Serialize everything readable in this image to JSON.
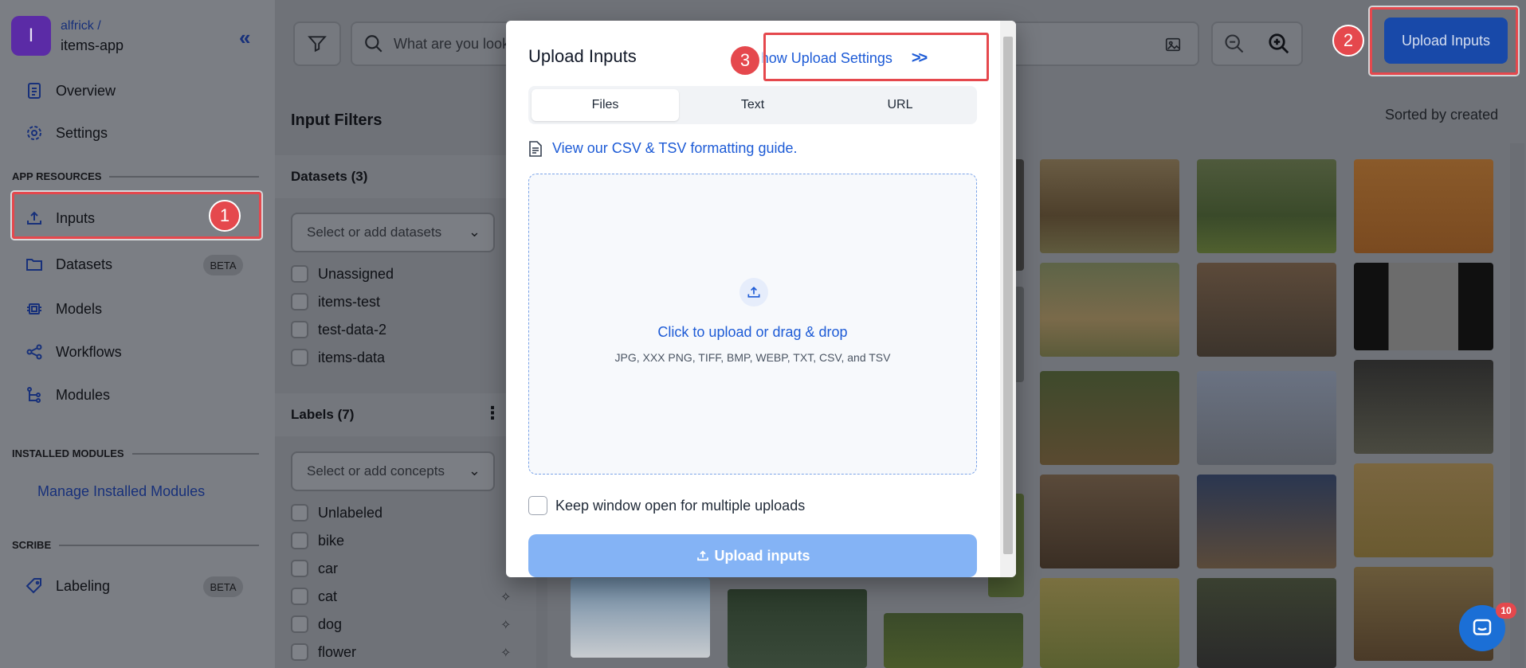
{
  "app": {
    "initial": "I",
    "user": "alfrick /",
    "name": "items-app"
  },
  "sidebar": {
    "top_items": [
      {
        "label": "Overview",
        "icon": "document-icon"
      },
      {
        "label": "Settings",
        "icon": "gear-icon"
      }
    ],
    "app_resources_label": "APP RESOURCES",
    "resource_items": [
      {
        "label": "Inputs",
        "icon": "upload-icon"
      },
      {
        "label": "Datasets",
        "icon": "folder-icon",
        "badge": "BETA"
      },
      {
        "label": "Models",
        "icon": "chip-icon"
      },
      {
        "label": "Workflows",
        "icon": "share-icon"
      },
      {
        "label": "Modules",
        "icon": "tree-icon"
      }
    ],
    "installed_modules_label": "INSTALLED MODULES",
    "manage_modules": "Manage Installed Modules",
    "scribe_label": "SCRIBE",
    "scribe_items": [
      {
        "label": "Labeling",
        "icon": "tag-icon",
        "badge": "BETA"
      }
    ]
  },
  "steps": {
    "one": "1",
    "two": "2",
    "three": "3"
  },
  "topbar": {
    "search_placeholder": "What are you look",
    "upload_button": "Upload Inputs"
  },
  "filters": {
    "title": "Input Filters",
    "sorted": "Sorted by created",
    "datasets_title": "Datasets (3)",
    "datasets_placeholder": "Select or add datasets",
    "datasets": [
      "Unassigned",
      "items-test",
      "test-data-2",
      "items-data"
    ],
    "labels_title": "Labels (7)",
    "labels_placeholder": "Select or add concepts",
    "labels": [
      "Unlabeled",
      "bike",
      "car",
      "cat",
      "dog",
      "flower"
    ]
  },
  "modal": {
    "title": "Upload Inputs",
    "settings_button": "Show Upload Settings",
    "tabs": [
      "Files",
      "Text",
      "URL"
    ],
    "guide_link": "View our CSV & TSV formatting guide.",
    "dropzone_title": "Click to upload or drag & drop",
    "dropzone_formats": "JPG, XXX PNG, TIFF, BMP, WEBP, TXT, CSV, and TSV",
    "keep_open": "Keep window open for multiple uploads",
    "upload_button": "Upload inputs"
  },
  "chat": {
    "badge": "10"
  },
  "colors": {
    "accent": "#1d5bd6",
    "highlight": "#e5484d",
    "primary_btn": "#1849a9"
  }
}
